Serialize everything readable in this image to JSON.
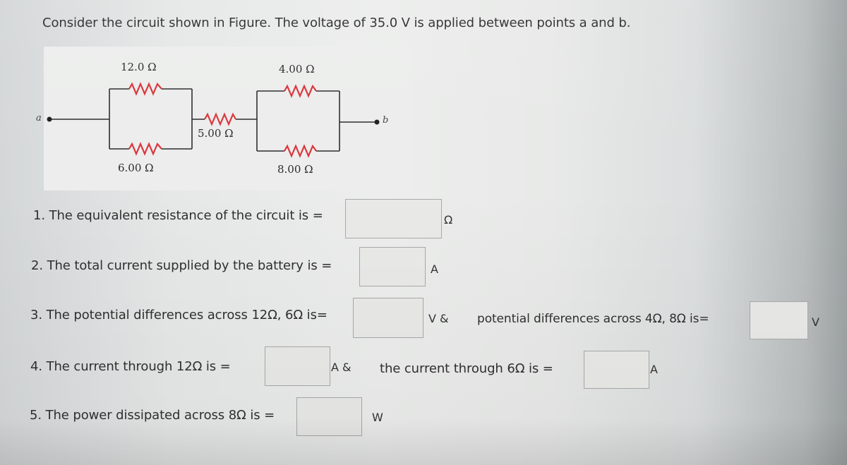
{
  "problem": {
    "intro": "Consider the circuit shown in Figure. The voltage of 35.0 V is applied between points a and b."
  },
  "figure": {
    "node_a": "a",
    "node_b": "b",
    "resistors": {
      "r12": "12.0 Ω",
      "r6": "6.00 Ω",
      "r5": "5.00 Ω",
      "r4": "4.00 Ω",
      "r8": "8.00 Ω"
    },
    "colors": {
      "resistor": "#d9343a",
      "wire": "#2b2b2b"
    }
  },
  "questions": [
    {
      "text": "1. The equivalent resistance of the circuit is =",
      "value": "",
      "unit": "Ω"
    },
    {
      "text": "2. The total current supplied by the battery is =",
      "value": "",
      "unit": "A"
    },
    {
      "text": "3. The potential differences across 12Ω, 6Ω is=",
      "value": "",
      "unit": "V &",
      "part2_text": "potential differences across 4Ω, 8Ω is=",
      "part2_value": "",
      "part2_unit": "V"
    },
    {
      "text": "4. The current through 12Ω is =",
      "value": "",
      "unit": "A &",
      "part2_text": "the current through 6Ω is =",
      "part2_value": "",
      "part2_unit": "A"
    },
    {
      "text": "5. The power dissipated across 8Ω is =",
      "value": "",
      "unit": "W"
    }
  ]
}
